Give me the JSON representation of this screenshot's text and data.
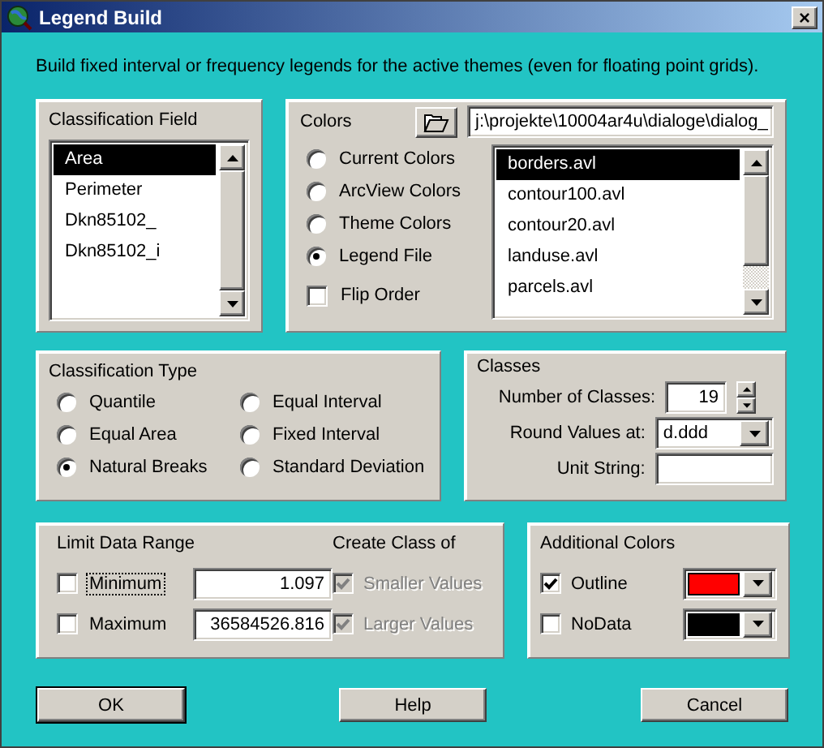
{
  "window": {
    "title": "Legend Build",
    "close": "×"
  },
  "description": "Build fixed interval or frequency legends for the active themes (even for floating point grids).",
  "classification_field": {
    "title": "Classification Field",
    "items": [
      {
        "label": "Area",
        "selected": true
      },
      {
        "label": "Perimeter",
        "selected": false
      },
      {
        "label": "Dkn85102_",
        "selected": false
      },
      {
        "label": "Dkn85102_i",
        "selected": false
      }
    ]
  },
  "colors": {
    "title": "Colors",
    "path": "j:\\projekte\\10004ar4u\\dialoge\\dialog_",
    "options": [
      {
        "label": "Current Colors",
        "selected": false
      },
      {
        "label": "ArcView Colors",
        "selected": false
      },
      {
        "label": "Theme Colors",
        "selected": false
      },
      {
        "label": "Legend File",
        "selected": true
      }
    ],
    "flip_order": {
      "label": "Flip Order",
      "checked": false
    },
    "files": [
      {
        "label": "borders.avl",
        "selected": true
      },
      {
        "label": "contour100.avl",
        "selected": false
      },
      {
        "label": "contour20.avl",
        "selected": false
      },
      {
        "label": "landuse.avl",
        "selected": false
      },
      {
        "label": "parcels.avl",
        "selected": false
      }
    ]
  },
  "classification_type": {
    "title": "Classification Type",
    "options": [
      {
        "label": "Quantile",
        "selected": false
      },
      {
        "label": "Equal Interval",
        "selected": false
      },
      {
        "label": "Equal Area",
        "selected": false
      },
      {
        "label": "Fixed Interval",
        "selected": false
      },
      {
        "label": "Natural Breaks",
        "selected": true
      },
      {
        "label": "Standard Deviation",
        "selected": false
      }
    ]
  },
  "classes": {
    "title": "Classes",
    "number_label": "Number of Classes:",
    "number": "19",
    "round_label": "Round Values at:",
    "round_value": "d.ddd",
    "unit_label": "Unit String:"
  },
  "limit_data_range": {
    "title": "Limit Data Range",
    "rows": [
      {
        "label": "Minimum",
        "checked": false,
        "focused": true,
        "value": "1.097"
      },
      {
        "label": "Maximum",
        "checked": false,
        "focused": false,
        "value": "36584526.816"
      }
    ],
    "create_title": "Create Class of",
    "create": [
      {
        "label": "Smaller Values",
        "checked": true,
        "disabled": true
      },
      {
        "label": "Larger Values",
        "checked": true,
        "disabled": true
      }
    ]
  },
  "additional_colors": {
    "title": "Additional Colors",
    "items": [
      {
        "label": "Outline",
        "checked": true,
        "color": "#ff0000"
      },
      {
        "label": "NoData",
        "checked": false,
        "color": "#000000"
      }
    ]
  },
  "buttons": [
    {
      "label": "OK",
      "default": true
    },
    {
      "label": "Help",
      "default": false
    },
    {
      "label": "Cancel",
      "default": false
    }
  ]
}
